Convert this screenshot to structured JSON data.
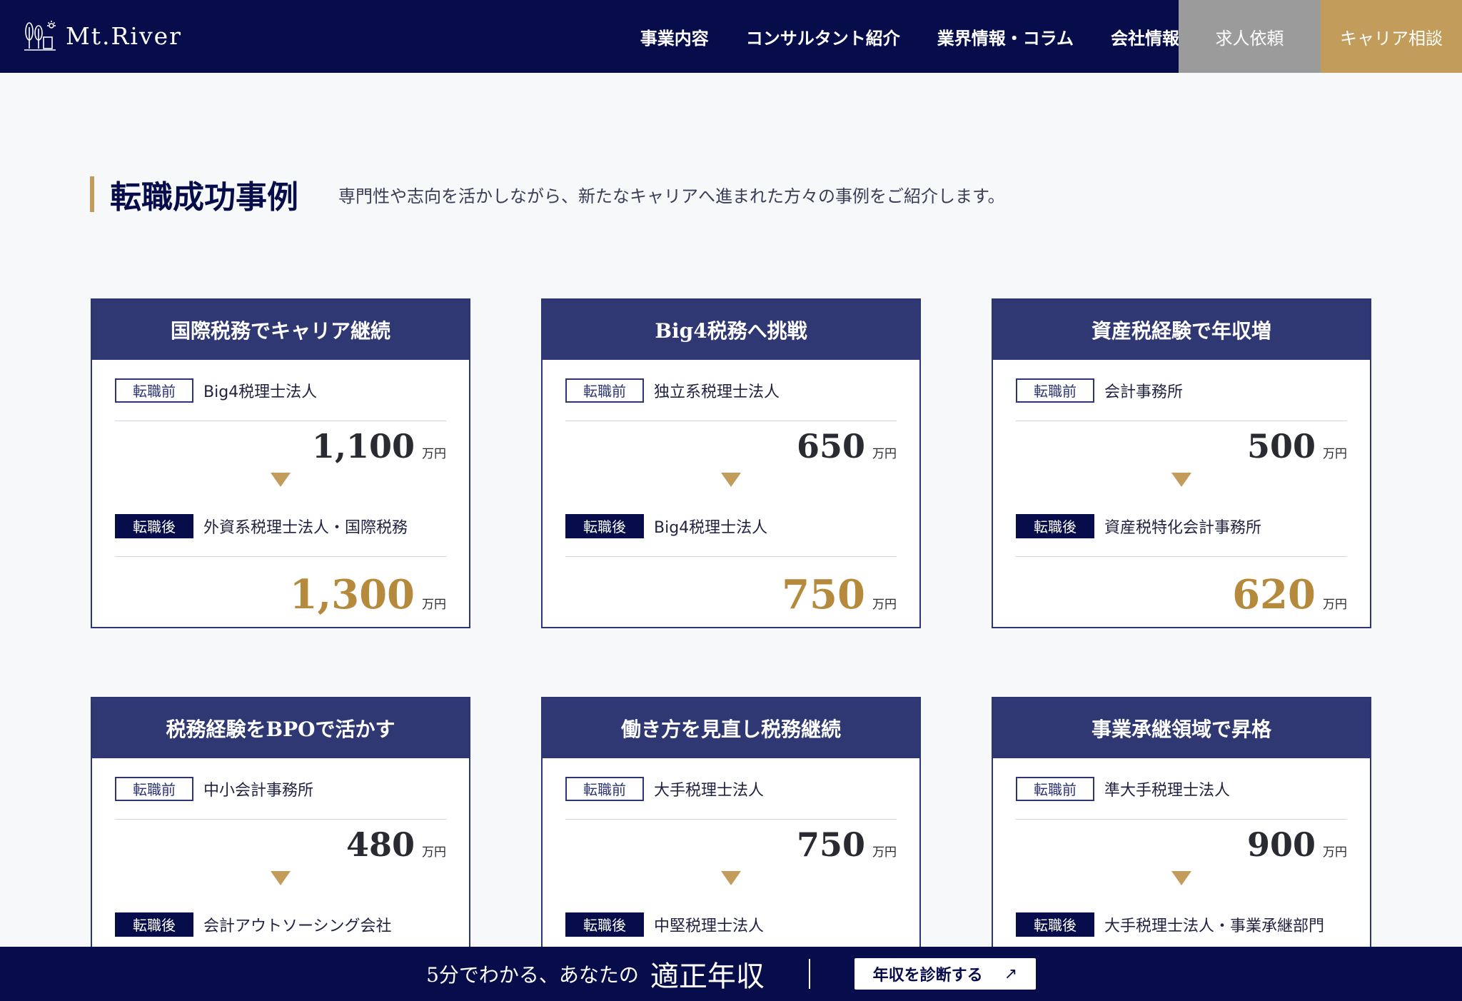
{
  "header": {
    "logo_text": "Mt.River",
    "nav": [
      "事業内容",
      "コンサルタント紹介",
      "業界情報・コラム",
      "会社情報"
    ],
    "request_label": "求人依頼",
    "career_label": "キャリア相談"
  },
  "section": {
    "title": "転職成功事例",
    "description": "専門性や志向を活かしながら、新たなキャリアへ進まれた方々の事例をご紹介します。"
  },
  "labels": {
    "before": "転職前",
    "after": "転職後",
    "unit": "万円"
  },
  "cases": [
    {
      "title": "国際税務でキャリア継続",
      "before_company": "Big4税理士法人",
      "before_salary": "1,100",
      "after_company": "外資系税理士法人・国際税務",
      "after_salary": "1,300"
    },
    {
      "title": "Big4税務へ挑戦",
      "before_company": "独立系税理士法人",
      "before_salary": "650",
      "after_company": "Big4税理士法人",
      "after_salary": "750"
    },
    {
      "title": "資産税経験で年収増",
      "before_company": "会計事務所",
      "before_salary": "500",
      "after_company": "資産税特化会計事務所",
      "after_salary": "620"
    },
    {
      "title": "税務経験をBPOで活かす",
      "before_company": "中小会計事務所",
      "before_salary": "480",
      "after_company": "会計アウトソーシング会社",
      "after_salary": ""
    },
    {
      "title": "働き方を見直し税務継続",
      "before_company": "大手税理士法人",
      "before_salary": "750",
      "after_company": "中堅税理士法人",
      "after_salary": ""
    },
    {
      "title": "事業承継領域で昇格",
      "before_company": "準大手税理士法人",
      "before_salary": "900",
      "after_company": "大手税理士法人・事業承継部門",
      "after_salary": ""
    }
  ],
  "banner": {
    "text": "5分でわかる、あなたの",
    "emphasis": "適正年収",
    "button_label": "年収を診断する",
    "button_icon": "↗"
  }
}
